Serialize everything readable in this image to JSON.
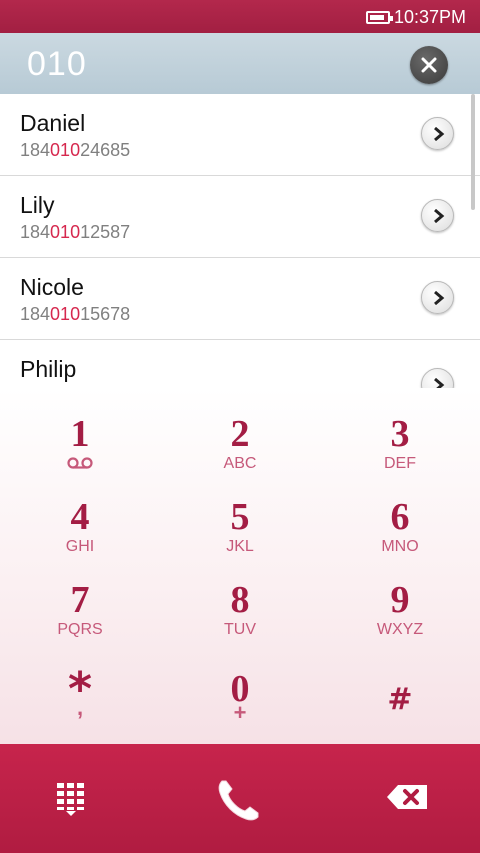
{
  "status_bar": {
    "time": "10:37PM",
    "battery_level": 0.85
  },
  "search": {
    "query": "010"
  },
  "contacts": [
    {
      "name": "Daniel",
      "number_pre": "184",
      "number_match": "010",
      "number_post": "24685"
    },
    {
      "name": "Lily",
      "number_pre": "184",
      "number_match": "010",
      "number_post": "12587"
    },
    {
      "name": "Nicole",
      "number_pre": "184",
      "number_match": "010",
      "number_post": "15678"
    },
    {
      "name": "Philip",
      "number_pre": "",
      "number_match": "",
      "number_post": ""
    }
  ],
  "keypad": [
    {
      "digit": "1",
      "letters": ""
    },
    {
      "digit": "2",
      "letters": "ABC"
    },
    {
      "digit": "3",
      "letters": "DEF"
    },
    {
      "digit": "4",
      "letters": "GHI"
    },
    {
      "digit": "5",
      "letters": "JKL"
    },
    {
      "digit": "6",
      "letters": "MNO"
    },
    {
      "digit": "7",
      "letters": "PQRS"
    },
    {
      "digit": "8",
      "letters": "TUV"
    },
    {
      "digit": "9",
      "letters": "WXYZ"
    },
    {
      "digit": "*",
      "letters": ","
    },
    {
      "digit": "0",
      "letters": "+"
    },
    {
      "digit": "#",
      "letters": ""
    }
  ],
  "icons": {
    "voicemail": "voicemail-icon",
    "dialpad": "dialpad-icon",
    "call": "phone-icon",
    "backspace": "backspace-icon",
    "clear": "close-icon",
    "detail": "chevron-right-icon"
  },
  "colors": {
    "brand": "#a31d44",
    "highlight": "#d6284e",
    "search_bar": "#c1d2dc"
  }
}
